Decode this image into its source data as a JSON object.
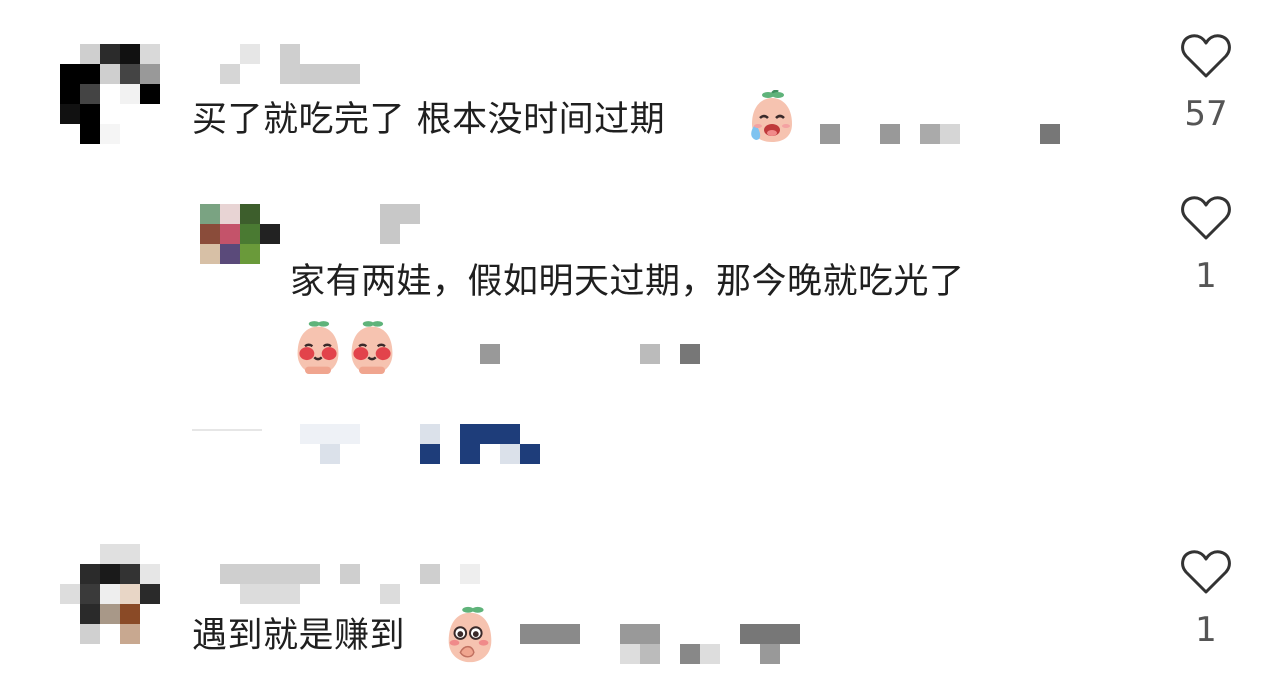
{
  "comments": [
    {
      "text": "买了就吃完了 根本没时间过期",
      "likes": "57",
      "emoji": "crying-face-emoji",
      "replies": [
        {
          "text": "家有两娃，假如明天过期，那今晚就吃光了",
          "likes": "1",
          "emoji": "blushing-face-emoji"
        }
      ]
    },
    {
      "text": "遇到就是赚到",
      "likes": "1",
      "emoji": "thinking-face-emoji"
    }
  ],
  "colors": {
    "text": "#1f1f1f",
    "count": "#555555",
    "heart_stroke": "#333333",
    "pixelated_link": "#1e3d7a"
  }
}
